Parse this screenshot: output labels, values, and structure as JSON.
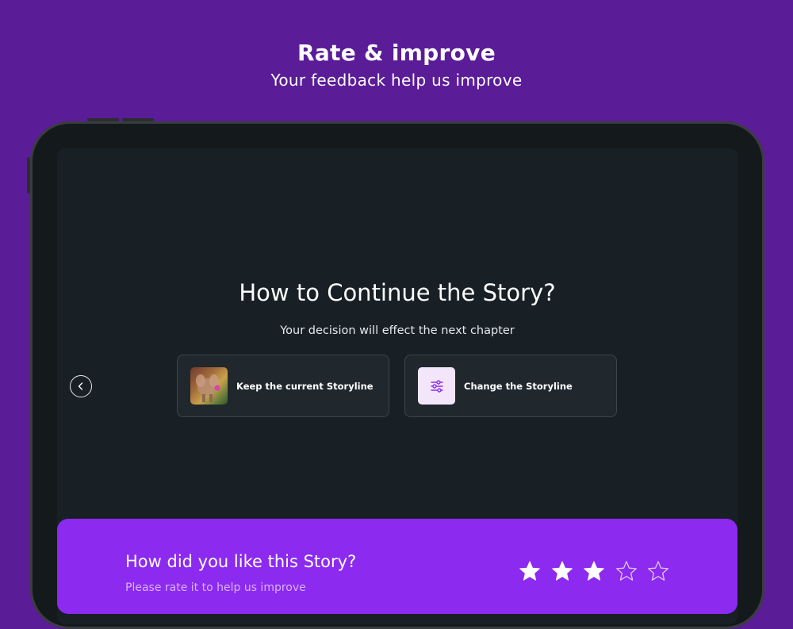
{
  "promo": {
    "title": "Rate & improve",
    "subtitle": "Your feedback help us improve"
  },
  "screen": {
    "title": "How to Continue the Story?",
    "subtitle": "Your decision will effect the next chapter",
    "back_icon": "chevron-left-icon",
    "options": [
      {
        "label": "Keep the current Storyline",
        "icon": "story-thumbnail"
      },
      {
        "label": "Change the Storyline",
        "icon": "sliders-icon"
      }
    ]
  },
  "rating": {
    "title": "How did you like this Story?",
    "subtitle": "Please rate it to help us improve",
    "value": 3,
    "max": 5
  },
  "colors": {
    "background": "#5b1c98",
    "device": "#141a1b",
    "screen": "#182026",
    "accent": "#8c2af0",
    "icon_accent": "#8c2af0"
  }
}
